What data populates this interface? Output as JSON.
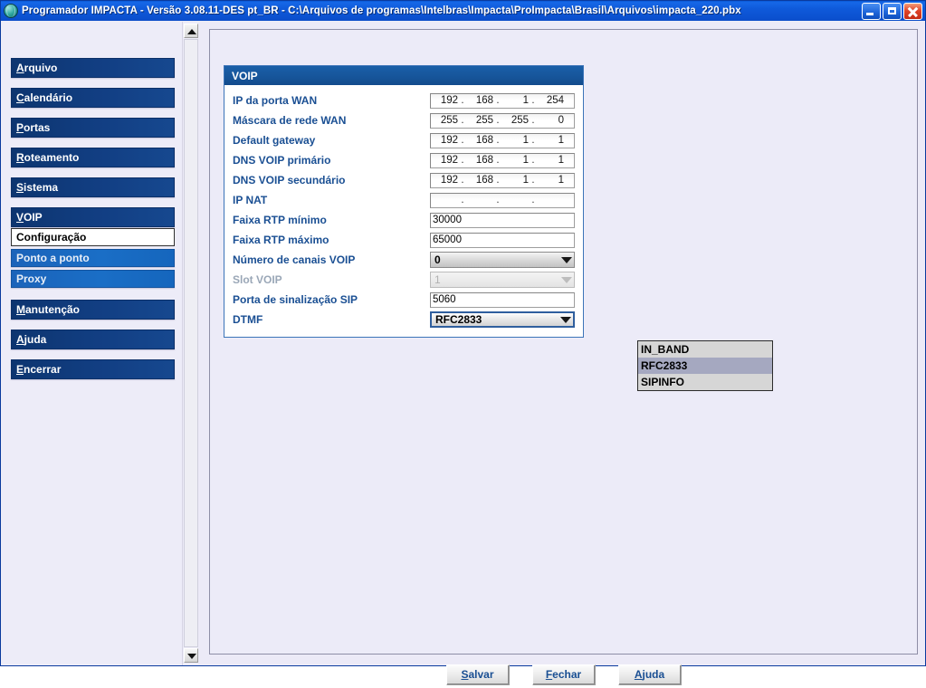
{
  "window": {
    "title": "Programador IMPACTA - Versão  3.08.11-DES pt_BR - C:\\Arquivos de programas\\Intelbras\\Impacta\\ProImpacta\\Brasil\\Arquivos\\impacta_220.pbx",
    "icon": "app-globe-icon",
    "controls": {
      "minimize": "minimize-icon",
      "restore": "restore-icon",
      "close": "close-icon"
    },
    "accent": "#0f5ada"
  },
  "sidebar": {
    "items": [
      {
        "label": "Arquivo",
        "mnemonic": "A",
        "rest": "rquivo",
        "type": "top"
      },
      {
        "label": "Calendário",
        "mnemonic": "C",
        "rest": "alendário",
        "type": "top"
      },
      {
        "label": "Portas",
        "mnemonic": "P",
        "rest": "ortas",
        "type": "top"
      },
      {
        "label": "Roteamento",
        "mnemonic": "R",
        "rest": "oteamento",
        "type": "top"
      },
      {
        "label": "Sistema",
        "mnemonic": "S",
        "rest": "istema",
        "type": "top"
      },
      {
        "label": "VOIP",
        "mnemonic": "V",
        "rest": "OIP",
        "type": "top"
      },
      {
        "label": "Configuração",
        "mnemonic": "",
        "rest": "Configuração",
        "type": "selected"
      },
      {
        "label": "Ponto a ponto",
        "mnemonic": "",
        "rest": "Ponto a ponto",
        "type": "sub"
      },
      {
        "label": "Proxy",
        "mnemonic": "",
        "rest": "Proxy",
        "type": "sub"
      },
      {
        "label": "Manutenção",
        "mnemonic": "M",
        "rest": "anutenção",
        "type": "top"
      },
      {
        "label": "Ajuda",
        "mnemonic": "A",
        "rest": "juda",
        "type": "top"
      },
      {
        "label": "Encerrar",
        "mnemonic": "E",
        "rest": "ncerrar",
        "type": "top"
      }
    ],
    "scrollbar": {
      "up": "scroll-up-arrow",
      "down": "scroll-down-arrow"
    }
  },
  "panel": {
    "title": "VOIP",
    "fields": [
      {
        "label": "IP da porta WAN",
        "type": "ip",
        "value": [
          "192",
          "168",
          "1",
          "254"
        ]
      },
      {
        "label": "Máscara de rede WAN",
        "type": "ip",
        "value": [
          "255",
          "255",
          "255",
          "0"
        ]
      },
      {
        "label": "Default gateway",
        "type": "ip",
        "value": [
          "192",
          "168",
          "1",
          "1"
        ]
      },
      {
        "label": "DNS VOIP primário",
        "type": "ip",
        "value": [
          "192",
          "168",
          "1",
          "1"
        ]
      },
      {
        "label": "DNS VOIP secundário",
        "type": "ip",
        "value": [
          "192",
          "168",
          "1",
          "1"
        ]
      },
      {
        "label": "IP NAT",
        "type": "ip",
        "value": [
          "",
          "",
          "",
          ""
        ]
      },
      {
        "label": "Faixa RTP mínimo",
        "type": "text",
        "value": "30000"
      },
      {
        "label": "Faixa RTP máximo",
        "type": "text",
        "value": "65000"
      },
      {
        "label": "Número de canais VOIP",
        "type": "combo",
        "value": "0",
        "disabled": false
      },
      {
        "label": "Slot VOIP",
        "type": "combo",
        "value": "1",
        "disabled": true
      },
      {
        "label": "Porta de sinalização SIP",
        "type": "text",
        "value": "5060"
      },
      {
        "label": "DTMF",
        "type": "combo-open",
        "value": "RFC2833",
        "disabled": false
      }
    ]
  },
  "dropdown": {
    "open": true,
    "options": [
      "IN_BAND",
      "RFC2833",
      "SIPINFO"
    ],
    "selected": "RFC2833"
  },
  "buttons": [
    {
      "label": "Salvar",
      "mnemonic": "S",
      "rest": "alvar"
    },
    {
      "label": "Fechar",
      "mnemonic": "F",
      "rest": "echar"
    },
    {
      "label": "Ajuda",
      "mnemonic": "A",
      "rest": "juda"
    }
  ]
}
